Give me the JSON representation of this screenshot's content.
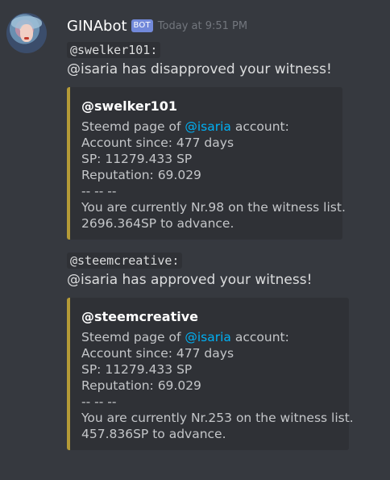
{
  "message": {
    "author": "GINAbot",
    "tag": "BOT",
    "timestamp": "Today at 9:51 PM"
  },
  "entries": [
    {
      "mention": "@swelker101:",
      "text": "@isaria has disapproved your witness!",
      "embed": {
        "title": "@swelker101",
        "steemd_prefix": "Steemd page of ",
        "steemd_link": "@isaria",
        "steemd_suffix": " account:",
        "account_since": "Account since: 477 days",
        "sp": "SP: 11279.433 SP",
        "reputation": "Reputation: 69.029",
        "separator": "-- -- --",
        "rank": "You are currently Nr.98 on the witness list.",
        "advance": "2696.364SP to advance."
      }
    },
    {
      "mention": "@steemcreative:",
      "text": "@isaria has approved your witness!",
      "embed": {
        "title": "@steemcreative",
        "steemd_prefix": "Steemd page of ",
        "steemd_link": "@isaria",
        "steemd_suffix": " account:",
        "account_since": "Account since: 477 days",
        "sp": "SP: 11279.433 SP",
        "reputation": "Reputation: 69.029",
        "separator": "-- -- --",
        "rank": "You are currently Nr.253 on the witness list.",
        "advance": "457.836SP to advance."
      }
    }
  ],
  "colors": {
    "background": "#36393f",
    "embed_background": "#2f3136",
    "embed_border": "#b59b37",
    "link": "#00b0f4",
    "bot_tag": "#7289da"
  }
}
